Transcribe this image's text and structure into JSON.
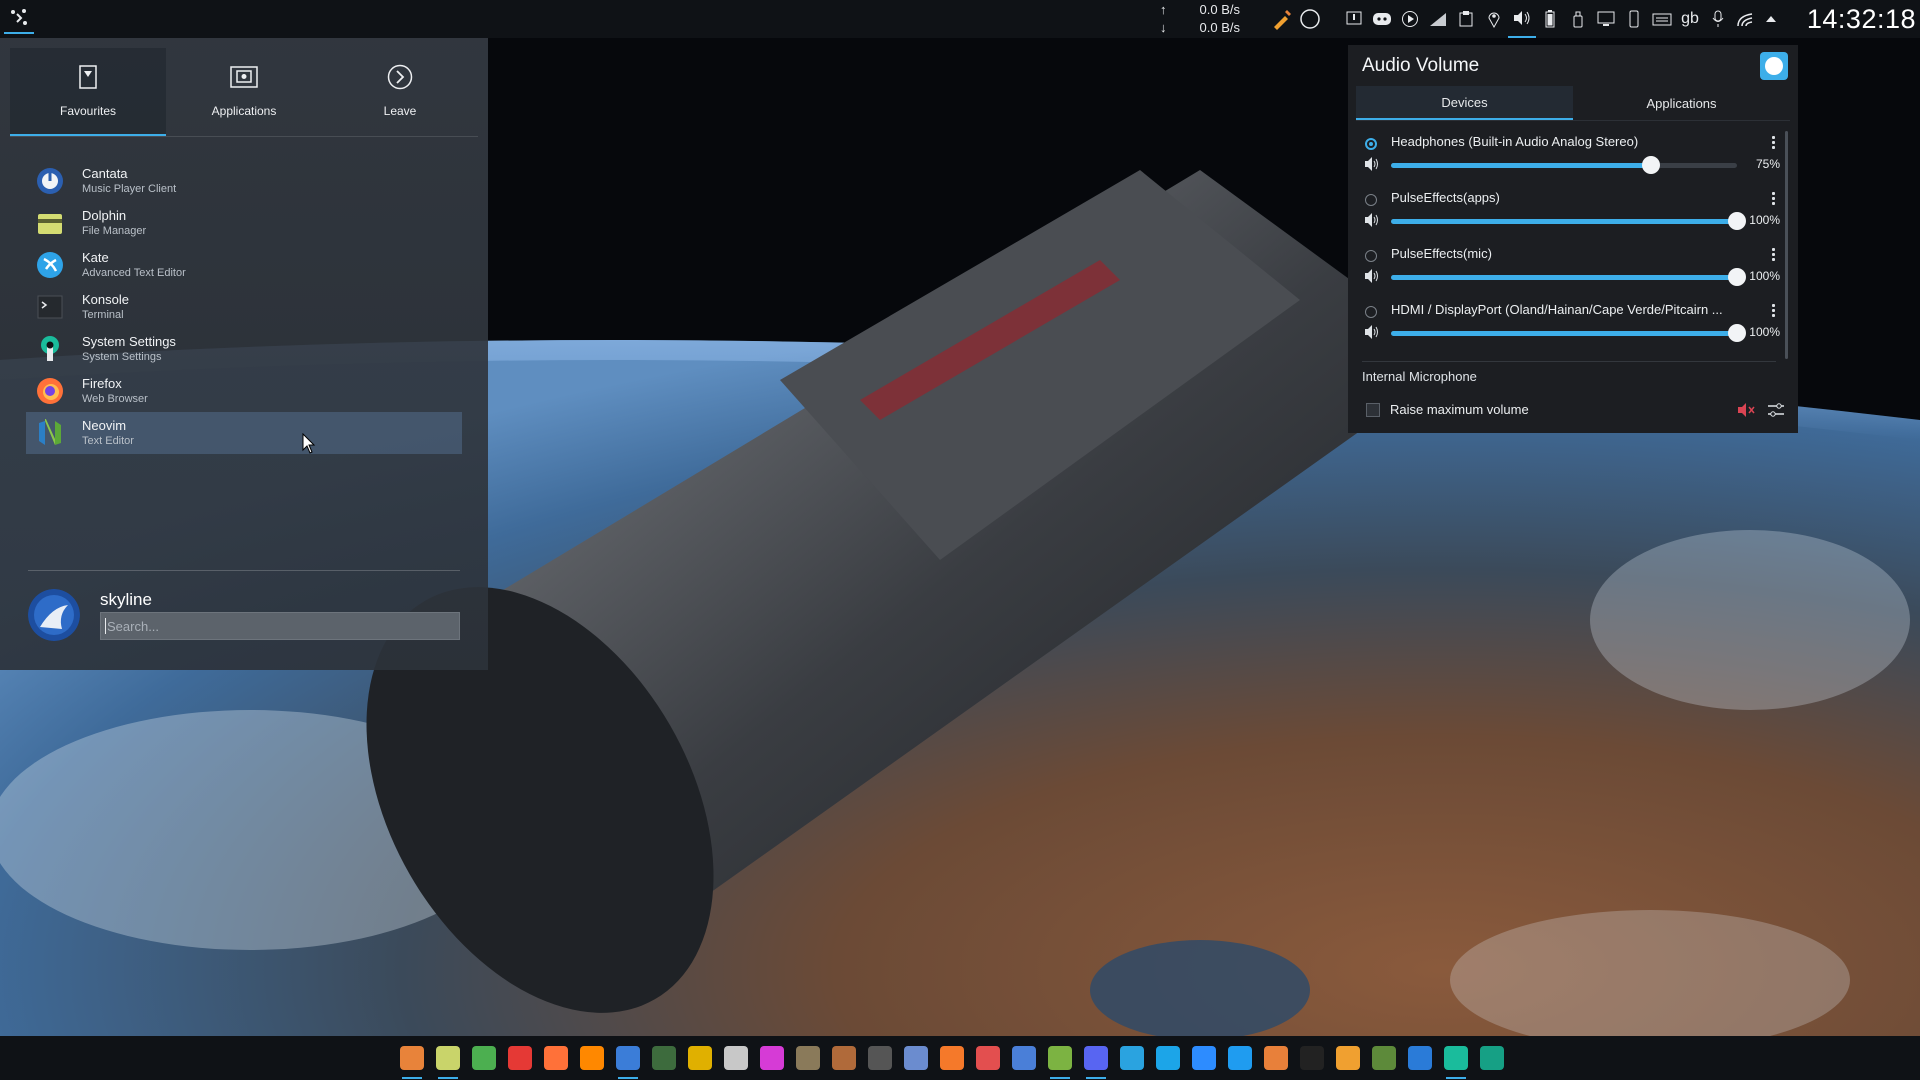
{
  "panel": {
    "net_upload": "0.0 B/s",
    "net_download": "0.0 B/s",
    "up_arrow": "↑",
    "down_arrow": "↓",
    "keyboard_layout": "gb",
    "clock": "14:32:18",
    "tray_icons": [
      "color-picker-icon",
      "circle-icon",
      "notification-icon",
      "discord-icon",
      "media-player-icon",
      "kdeconnect-icon",
      "clipboard-icon",
      "location-icon",
      "volume-icon",
      "battery-icon",
      "usb-device-icon",
      "display-icon",
      "phone-icon",
      "keyboard-icon",
      "microphone-icon",
      "network-icon",
      "expand-arrow-icon"
    ]
  },
  "launcher": {
    "tabs": [
      {
        "label": "Favourites",
        "icon": "bookmark-icon"
      },
      {
        "label": "Applications",
        "icon": "applications-icon"
      },
      {
        "label": "Leave",
        "icon": "leave-icon"
      }
    ],
    "selected_tab": "Favourites",
    "favourites": [
      {
        "name": "Cantata",
        "desc": "Music Player Client",
        "icon": "cantata-icon"
      },
      {
        "name": "Dolphin",
        "desc": "File Manager",
        "icon": "dolphin-icon"
      },
      {
        "name": "Kate",
        "desc": "Advanced Text Editor",
        "icon": "kate-icon"
      },
      {
        "name": "Konsole",
        "desc": "Terminal",
        "icon": "konsole-icon"
      },
      {
        "name": "System Settings",
        "desc": "System Settings",
        "icon": "system-settings-icon"
      },
      {
        "name": "Firefox",
        "desc": "Web Browser",
        "icon": "firefox-icon"
      },
      {
        "name": "Neovim",
        "desc": "Text Editor",
        "icon": "neovim-icon"
      }
    ],
    "user_name": "skyline",
    "search_placeholder": "Search..."
  },
  "audio": {
    "title": "Audio Volume",
    "tabs": [
      "Devices",
      "Applications"
    ],
    "selected_tab": "Devices",
    "devices": [
      {
        "name": "Headphones (Built-in Audio Analog Stereo)",
        "volume": 75,
        "volume_label": "75%",
        "default": true
      },
      {
        "name": "PulseEffects(apps)",
        "volume": 100,
        "volume_label": "100%",
        "default": false
      },
      {
        "name": "PulseEffects(mic)",
        "volume": 100,
        "volume_label": "100%",
        "default": false
      },
      {
        "name": "HDMI / DisplayPort (Oland/Hainan/Cape Verde/Pitcairn ...",
        "volume": 100,
        "volume_label": "100%",
        "default": false
      }
    ],
    "mic_section": "Internal Microphone",
    "raise_max_label": "Raise maximum volume",
    "raise_max_checked": false
  },
  "dock": {
    "apps": [
      {
        "name": "sublime-text-icon",
        "color": "#e8833a",
        "running": true
      },
      {
        "name": "dolphin-files-icon",
        "color": "#c9d46a",
        "running": true
      },
      {
        "name": "folder-icon",
        "color": "#4caf50",
        "running": false
      },
      {
        "name": "ark-icon",
        "color": "#e53935",
        "running": false
      },
      {
        "name": "firefox-dock-icon",
        "color": "#ff7139",
        "running": false
      },
      {
        "name": "vlc-icon",
        "color": "#ff8800",
        "running": false
      },
      {
        "name": "cantata-dock-icon",
        "color": "#3b7dd8",
        "running": true
      },
      {
        "name": "system-monitor-icon",
        "color": "#3d6b3d",
        "running": false
      },
      {
        "name": "speaker-icon",
        "color": "#e0b000",
        "running": false
      },
      {
        "name": "obs-icon",
        "color": "#c8c8c8",
        "running": false
      },
      {
        "name": "color-app-icon",
        "color": "#d63bd6",
        "running": false
      },
      {
        "name": "gimp-icon",
        "color": "#8a7a5a",
        "running": false
      },
      {
        "name": "package-icon",
        "color": "#b06a3a",
        "running": false
      },
      {
        "name": "inkscape-icon",
        "color": "#555555",
        "running": false
      },
      {
        "name": "kdenlive-icon",
        "color": "#6b8ccf",
        "running": false
      },
      {
        "name": "blender-icon",
        "color": "#f5792a",
        "running": false
      },
      {
        "name": "calendar-icon",
        "color": "#e34f4f",
        "running": false
      },
      {
        "name": "document-icon",
        "color": "#4a7fd8",
        "running": false
      },
      {
        "name": "android-icon",
        "color": "#7cb342",
        "running": true
      },
      {
        "name": "discord-dock-icon",
        "color": "#5865f2",
        "running": true
      },
      {
        "name": "telegram-icon",
        "color": "#2aa3e0",
        "running": false
      },
      {
        "name": "skype-icon",
        "color": "#1ca5e8",
        "running": false
      },
      {
        "name": "zoom-icon",
        "color": "#2d8cff",
        "running": false
      },
      {
        "name": "vscode-icon",
        "color": "#1f9cf0",
        "running": false
      },
      {
        "name": "orange-app-icon",
        "color": "#e8803a",
        "running": false
      },
      {
        "name": "tux-icon",
        "color": "#222222",
        "running": false
      },
      {
        "name": "gear-app-icon",
        "color": "#f0a030",
        "running": false
      },
      {
        "name": "minecraft-icon",
        "color": "#5d8a3a",
        "running": false
      },
      {
        "name": "waveform-icon",
        "color": "#2a7bd8",
        "running": false
      },
      {
        "name": "system-settings-dock-icon",
        "color": "#1abc9c",
        "running": true
      },
      {
        "name": "steam-like-icon",
        "color": "#16a085",
        "running": false
      }
    ]
  },
  "colors": {
    "accent": "#3daee9",
    "panel_bg": "#0f1216",
    "popup_bg": "#1c1e22"
  }
}
